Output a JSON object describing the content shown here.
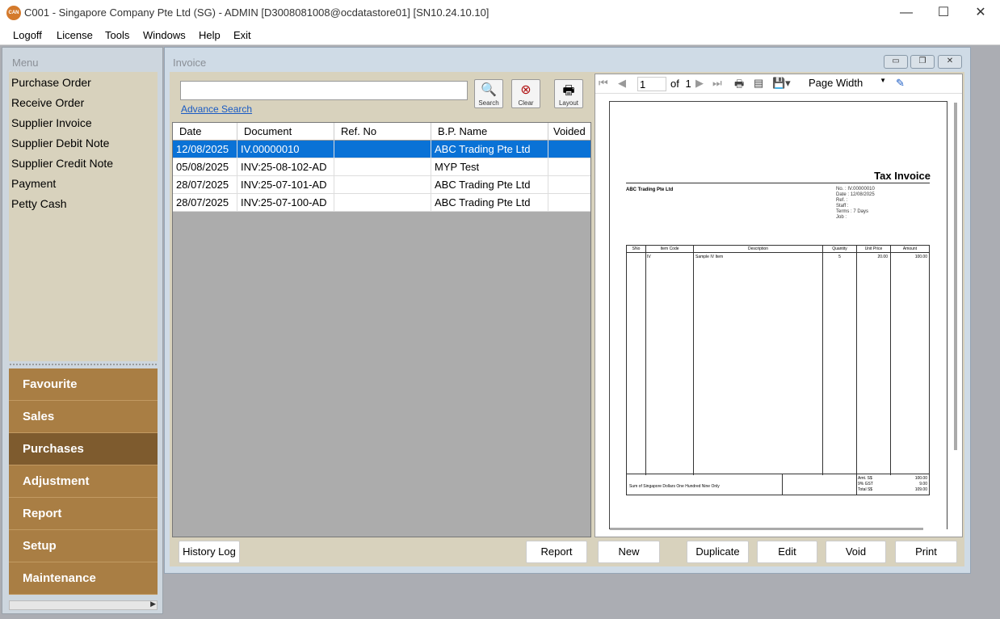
{
  "window": {
    "icon_text": "CAN",
    "title": "C001 - Singapore Company Pte Ltd (SG) - ADMIN [D3008081008@ocdatastore01] [SN10.24.10.10]",
    "minimize": "—",
    "maximize": "☐",
    "close": "✕"
  },
  "menubar": [
    "Logoff",
    "License",
    "Tools",
    "Windows",
    "Help",
    "Exit"
  ],
  "left_panel": {
    "heading": "Menu",
    "menu_items": [
      "Purchase Order",
      "Receive Order",
      "Supplier Invoice",
      "Supplier Debit Note",
      "Supplier Credit Note",
      "Payment",
      "Petty Cash"
    ],
    "nav": [
      "Favourite",
      "Sales",
      "Purchases",
      "Adjustment",
      "Report",
      "Setup",
      "Maintenance"
    ],
    "active_nav": "Purchases"
  },
  "invoice": {
    "title": "Invoice",
    "search_value": "",
    "advance_search": "Advance Search",
    "tools": [
      {
        "label": "Search",
        "icon": "magnifier-icon"
      },
      {
        "label": "Clear",
        "icon": "clear-icon"
      },
      {
        "label": "Layout",
        "icon": "layout-icon"
      }
    ],
    "columns": [
      "Date",
      "Document",
      "Ref. No",
      "B.P. Name",
      "Voided"
    ],
    "rows": [
      [
        "12/08/2025",
        "IV.00000010",
        "",
        "ABC Trading Pte Ltd",
        ""
      ],
      [
        "05/08/2025",
        "INV:25-08-102-AD",
        "",
        "MYP Test",
        ""
      ],
      [
        "28/07/2025",
        "INV:25-07-101-AD",
        "",
        "ABC Trading Pte Ltd",
        ""
      ],
      [
        "28/07/2025",
        "INV:25-07-100-AD",
        "",
        "ABC Trading Pte Ltd",
        ""
      ]
    ],
    "selected_row": 0,
    "buttons": {
      "history": "History Log",
      "report": "Report",
      "new": "New",
      "duplicate": "Duplicate",
      "edit": "Edit",
      "void": "Void",
      "print": "Print"
    },
    "accent": "#0a72d6"
  },
  "preview": {
    "page": "1",
    "of": "of",
    "total": "1",
    "zoom": "Page Width",
    "doc": {
      "title": "Tax Invoice",
      "company": "ABC Trading Pte Ltd",
      "meta": [
        {
          "label": "No.",
          "value": ": IV.00000010"
        },
        {
          "label": "Date",
          "value": ": 12/08/2025"
        },
        {
          "label": "Ref.",
          "value": ":"
        },
        {
          "label": "Staff",
          "value": ":"
        },
        {
          "label": "Terms",
          "value": ": 7 Days"
        },
        {
          "label": "Job",
          "value": ":"
        }
      ],
      "headers": [
        "SNo",
        "Item Code",
        "Description",
        "Quantity",
        "Unit Price",
        "Amount"
      ],
      "line": [
        "",
        "IV",
        "Sample IV Item",
        "5",
        "20.00",
        "100.00"
      ],
      "amount_words": "Sum of Singapore Dollars One Hundred Nine Only",
      "totals": [
        {
          "label": "Amt. S$",
          "value": "100.00"
        },
        {
          "label": "9% GST",
          "value": "9.00"
        },
        {
          "label": "Total S$",
          "value": "109.00"
        }
      ]
    }
  }
}
